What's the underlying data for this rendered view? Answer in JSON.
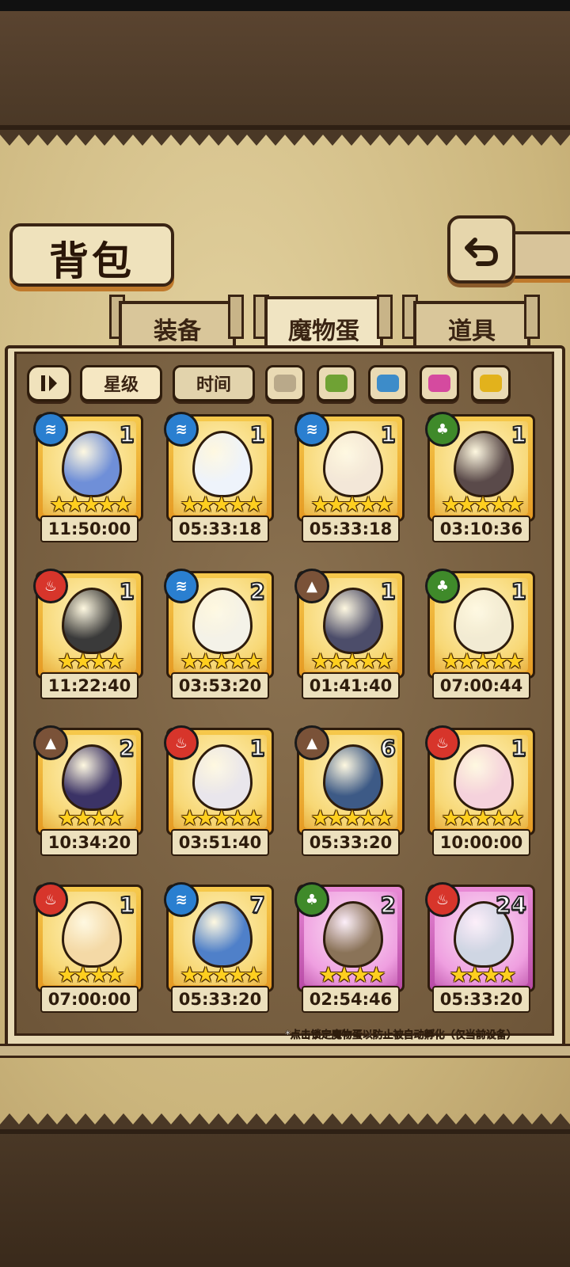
{
  "title": "背包",
  "tabs": [
    {
      "label": "装备",
      "active": false
    },
    {
      "label": "魔物蛋",
      "active": true
    },
    {
      "label": "道具",
      "active": false
    }
  ],
  "filters": {
    "sort_star": "星级",
    "sort_time": "时间"
  },
  "colors": {
    "swatches": [
      "#b9a98a",
      "#6fa234",
      "#3d8cc9",
      "#d54a9f",
      "#e2b21c"
    ],
    "water": "#2a7fd0",
    "fire": "#d7352b",
    "earth": "#7a5238",
    "grass": "#3f8a2a"
  },
  "eggs": [
    {
      "element": "water",
      "count": "1",
      "stars": 5,
      "timer": "11:50:00",
      "rarity": "gold",
      "egg_color": "#6f8fd8"
    },
    {
      "element": "water",
      "count": "1",
      "stars": 5,
      "timer": "05:33:18",
      "rarity": "gold",
      "egg_color": "#eef3fb"
    },
    {
      "element": "water",
      "count": "1",
      "stars": 5,
      "timer": "05:33:18",
      "rarity": "gold",
      "egg_color": "#f3e7d8"
    },
    {
      "element": "grass",
      "count": "1",
      "stars": 5,
      "timer": "03:10:36",
      "rarity": "gold",
      "egg_color": "#5a4a4a"
    },
    {
      "element": "fire",
      "count": "1",
      "stars": 4,
      "timer": "11:22:40",
      "rarity": "gold",
      "egg_color": "#3a3a3a"
    },
    {
      "element": "water",
      "count": "2",
      "stars": 5,
      "timer": "03:53:20",
      "rarity": "gold",
      "egg_color": "#f4f2e8"
    },
    {
      "element": "earth",
      "count": "1",
      "stars": 5,
      "timer": "01:41:40",
      "rarity": "gold",
      "egg_color": "#4c4d6a"
    },
    {
      "element": "grass",
      "count": "1",
      "stars": 5,
      "timer": "07:00:44",
      "rarity": "gold",
      "egg_color": "#f2ebd3"
    },
    {
      "element": "earth",
      "count": "2",
      "stars": 4,
      "timer": "10:34:20",
      "rarity": "gold",
      "egg_color": "#3b3366"
    },
    {
      "element": "fire",
      "count": "1",
      "stars": 5,
      "timer": "03:51:40",
      "rarity": "gold",
      "egg_color": "#e9e6ec"
    },
    {
      "element": "earth",
      "count": "6",
      "stars": 5,
      "timer": "05:33:20",
      "rarity": "gold",
      "egg_color": "#3d5a86"
    },
    {
      "element": "fire",
      "count": "1",
      "stars": 5,
      "timer": "10:00:00",
      "rarity": "gold",
      "egg_color": "#f5d2dc"
    },
    {
      "element": "fire",
      "count": "1",
      "stars": 4,
      "timer": "07:00:00",
      "rarity": "gold",
      "egg_color": "#f4d9a6"
    },
    {
      "element": "water",
      "count": "7",
      "stars": 5,
      "timer": "05:33:20",
      "rarity": "gold",
      "egg_color": "#4f80c9"
    },
    {
      "element": "grass",
      "count": "2",
      "stars": 4,
      "timer": "02:54:46",
      "rarity": "pink",
      "egg_color": "#8a7358"
    },
    {
      "element": "fire",
      "count": "24",
      "stars": 4,
      "timer": "05:33:20",
      "rarity": "pink",
      "egg_color": "#cfd6e3"
    }
  ],
  "note": "*点击锁定魔物蛋以防止被自动孵化（仅当前设备）"
}
